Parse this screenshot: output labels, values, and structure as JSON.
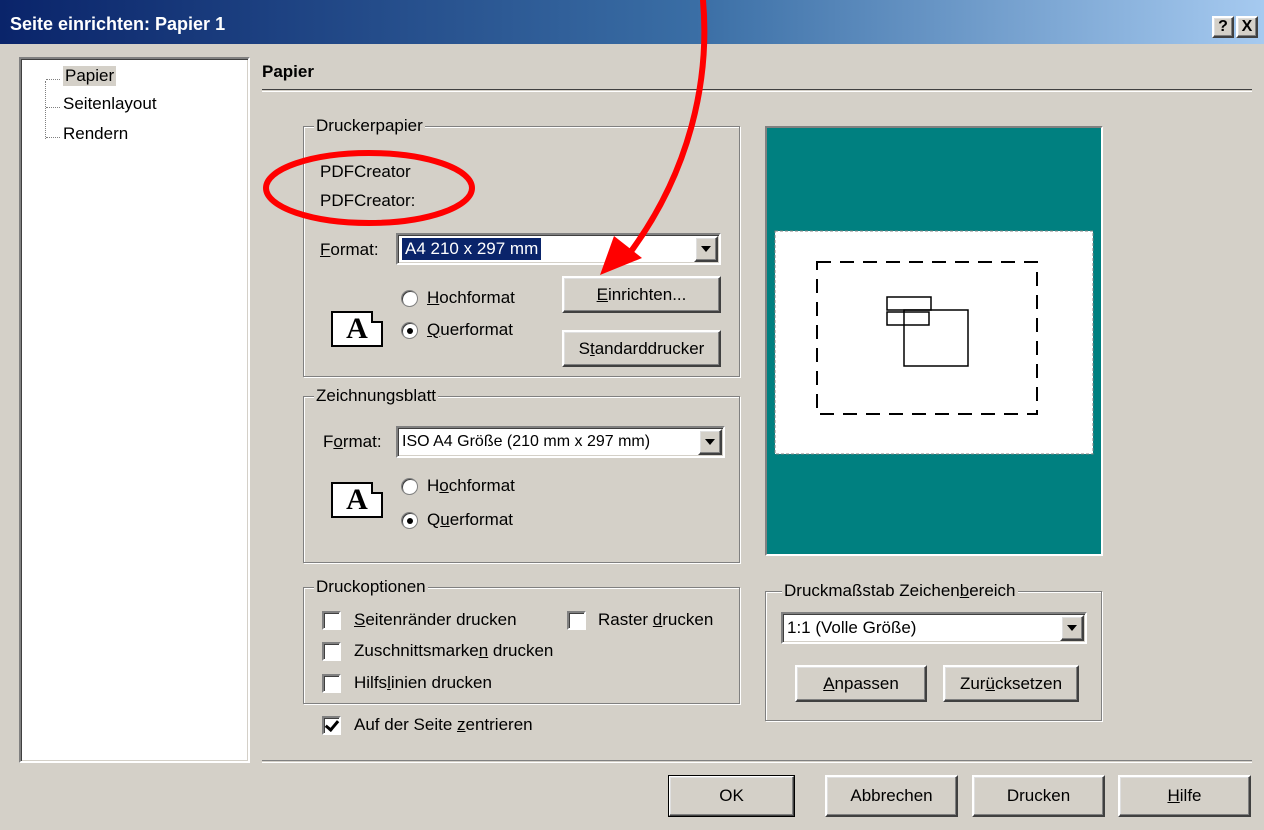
{
  "window": {
    "title": "Seite einrichten: Papier 1",
    "help_btn": "?",
    "close_btn": "X"
  },
  "tree": {
    "items": [
      {
        "label": "Papier",
        "selected": true
      },
      {
        "label": "Seitenlayout",
        "selected": false
      },
      {
        "label": "Rendern",
        "selected": false
      }
    ]
  },
  "heading": "Papier",
  "druckerpapier": {
    "group_title": "Druckerpapier",
    "printer_name": "PDFCreator",
    "printer_port": "PDFCreator:",
    "format_label_first": "F",
    "format_label_rest": "ormat:",
    "format_value": "A4 210 x 297 mm",
    "orientation_icon": "A",
    "hoch_u": "H",
    "hoch_rest": "ochformat",
    "quer_u": "Q",
    "quer_rest": "uerformat",
    "orientation_selected": "Querformat",
    "setup_btn_u": "E",
    "setup_btn_rest": "inrichten...",
    "default_btn_pre": "S",
    "default_btn_u": "t",
    "default_btn_rest": "andarddrucker"
  },
  "zeichnungsblatt": {
    "group_title": "Zeichnungsblatt",
    "format_label_pre": "F",
    "format_label_u": "o",
    "format_label_rest": "rmat:",
    "format_value": "ISO A4 Größe (210 mm x 297 mm)",
    "orientation_icon": "A",
    "hoch_pre": "H",
    "hoch_u": "o",
    "hoch_rest": "chformat",
    "quer_pre": "Q",
    "quer_u": "u",
    "quer_rest": "erformat",
    "orientation_selected": "Querformat"
  },
  "druckoptionen": {
    "group_title": "Druckoptionen",
    "seitenraender_u": "S",
    "seitenraender_rest": "eitenränder drucken",
    "raster_pre": "Raster ",
    "raster_u": "d",
    "raster_rest": "rucken",
    "zuschnitt_pre": "Zuschnittsmarke",
    "zuschnitt_u": "n",
    "zuschnitt_rest": " drucken",
    "hilfslinien_pre": "Hilfs",
    "hilfslinien_u": "l",
    "hilfslinien_rest": "inien drucken",
    "seitenraender_checked": false,
    "raster_checked": false,
    "zuschnitt_checked": false,
    "hilfslinien_checked": false
  },
  "center": {
    "pre": "Auf der Seite ",
    "u": "z",
    "rest": "entrieren",
    "checked": true
  },
  "scale": {
    "group_pre": "Druckmaßstab Zeichen",
    "group_u": "b",
    "group_rest": "ereich",
    "value": "1:1 (Volle Größe)",
    "fit_u": "A",
    "fit_rest": "npassen",
    "reset_pre": "Zur",
    "reset_u": "ü",
    "reset_rest": "cksetzen"
  },
  "buttons": {
    "ok": "OK",
    "cancel": "Abbrechen",
    "print": "Drucken",
    "help_u": "H",
    "help_rest": "ilfe"
  },
  "colors": {
    "preview_bg": "#008080",
    "annotation": "#ff0000",
    "selection": "#0a246a"
  }
}
